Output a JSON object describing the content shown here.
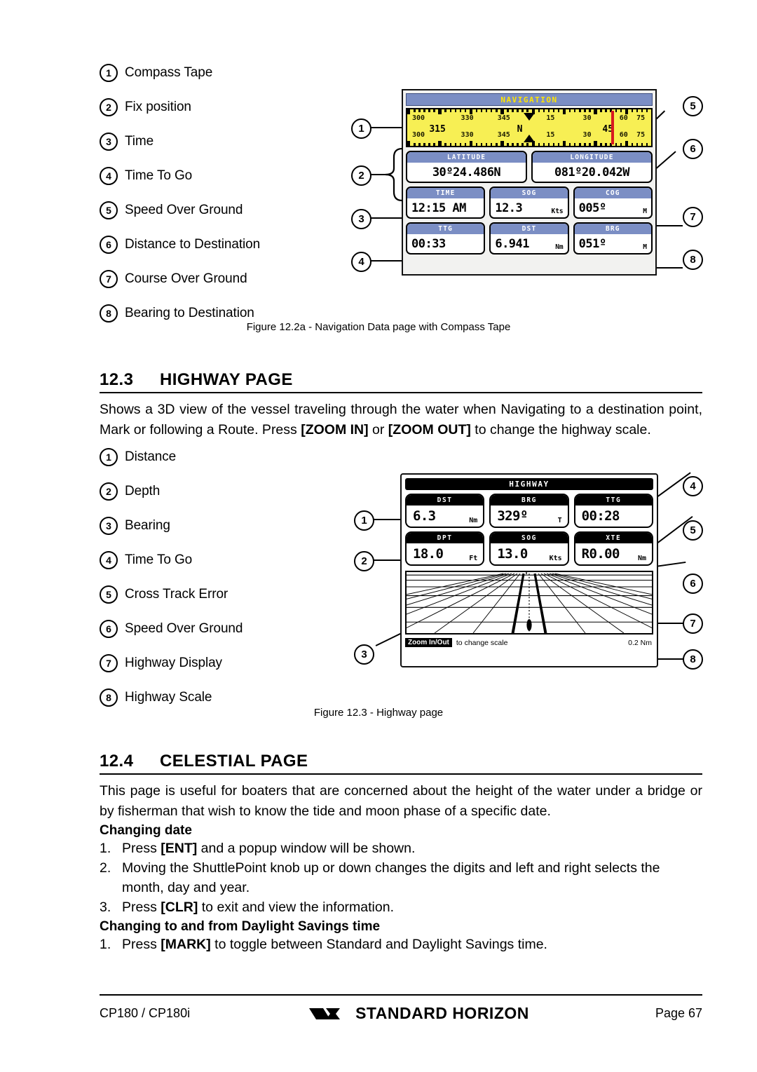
{
  "nav_figure": {
    "legend": [
      {
        "n": "1",
        "label": "Compass Tape"
      },
      {
        "n": "2",
        "label": "Fix position"
      },
      {
        "n": "3",
        "label": "Time"
      },
      {
        "n": "4",
        "label": "Time To Go"
      },
      {
        "n": "5",
        "label": "Speed Over Ground"
      },
      {
        "n": "6",
        "label": "Distance to Destination"
      },
      {
        "n": "7",
        "label": "Course Over Ground"
      },
      {
        "n": "8",
        "label": "Bearing to Destination"
      }
    ],
    "caption": "Figure 12.2a - Navigation Data page with Compass Tape",
    "device": {
      "title": "NAVIGATION",
      "compass": {
        "upper_labels": [
          "300",
          "330",
          "345",
          "15",
          "30",
          "60",
          "75"
        ],
        "lower_labels": [
          "300",
          "330",
          "345",
          "15",
          "30",
          "60",
          "75"
        ],
        "center_labels": [
          "315",
          "N",
          "45"
        ],
        "tape_color": "#f7ef54",
        "marker_color": "#d71920"
      },
      "fields": [
        {
          "head": "LATITUDE",
          "value": "30º24.486N",
          "unit": ""
        },
        {
          "head": "LONGITUDE",
          "value": "081º20.042W",
          "unit": ""
        },
        {
          "head": "TIME",
          "value": "12:15 AM",
          "unit": ""
        },
        {
          "head": "SOG",
          "value": "12.3",
          "unit": "Kts"
        },
        {
          "head": "COG",
          "value": "005º",
          "unit": "M"
        },
        {
          "head": "TTG",
          "value": "00:33",
          "unit": ""
        },
        {
          "head": "DST",
          "value": "6.941",
          "unit": "Nm"
        },
        {
          "head": "BRG",
          "value": "051º",
          "unit": "M"
        }
      ],
      "markers_left": [
        "1",
        "2",
        "3",
        "4"
      ],
      "markers_right": [
        "5",
        "6",
        "7",
        "8"
      ],
      "title_bar_color": "#7b8ec4",
      "title_text_color": "#ffe400"
    }
  },
  "section_highway": {
    "number": "12.3",
    "title": "HIGHWAY PAGE",
    "paragraph_part1": "Shows a 3D view of the vessel traveling through the water when Navigating to a destination point, Mark or following a Route. Press ",
    "key_zoom_in": "[ZOOM IN]",
    "paragraph_mid": " or ",
    "key_zoom_out": "[ZOOM OUT]",
    "paragraph_part2": " to change the highway scale."
  },
  "hw_figure": {
    "legend": [
      {
        "n": "1",
        "label": "Distance"
      },
      {
        "n": "2",
        "label": "Depth"
      },
      {
        "n": "3",
        "label": "Bearing"
      },
      {
        "n": "4",
        "label": "Time To Go"
      },
      {
        "n": "5",
        "label": "Cross Track Error"
      },
      {
        "n": "6",
        "label": "Speed Over Ground"
      },
      {
        "n": "7",
        "label": "Highway Display"
      },
      {
        "n": "8",
        "label": "Highway Scale"
      }
    ],
    "caption": "Figure 12.3 -  Highway page",
    "device": {
      "title": "HIGHWAY",
      "fields": [
        {
          "head": "DST",
          "value": "6.3",
          "unit": "Nm"
        },
        {
          "head": "BRG",
          "value": "329º",
          "unit": "T"
        },
        {
          "head": "TTG",
          "value": "00:28",
          "unit": ""
        },
        {
          "head": "DPT",
          "value": "18.0",
          "unit": "Ft"
        },
        {
          "head": "SOG",
          "value": "13.0",
          "unit": "Kts"
        },
        {
          "head": "XTE",
          "value": "R0.00",
          "unit": "Nm"
        }
      ],
      "zoom_button": "Zoom In/Out",
      "zoom_note": "to change scale",
      "scale": "0.2 Nm",
      "markers_left": [
        "1",
        "2",
        "3"
      ],
      "markers_right": [
        "4",
        "5",
        "6",
        "7",
        "8"
      ]
    }
  },
  "section_celestial": {
    "number": "12.4",
    "title": "CELESTIAL PAGE",
    "paragraph": "This page is useful for boaters that are concerned about the height of the water under a bridge or by fisherman that wish to know the tide and moon phase of a specific date.",
    "sub1": "Changing date",
    "steps1": [
      {
        "n": "1.",
        "pre": "Press ",
        "key": "[ENT]",
        "post": " and a popup window will be shown."
      },
      {
        "n": "2.",
        "pre": "Moving the ShuttlePoint knob up or down changes the digits and left and right selects the month, day and year.",
        "key": "",
        "post": ""
      },
      {
        "n": "3.",
        "pre": "Press ",
        "key": "[CLR]",
        "post": " to exit and view the information."
      }
    ],
    "sub2": "Changing to and from Daylight Savings time",
    "steps2": [
      {
        "n": "1.",
        "pre": "Press ",
        "key": "[MARK]",
        "post": " to toggle between Standard and Daylight Savings time."
      }
    ]
  },
  "footer": {
    "model": "CP180 / CP180i",
    "brand": "STANDARD HORIZON",
    "page": "Page 67"
  }
}
